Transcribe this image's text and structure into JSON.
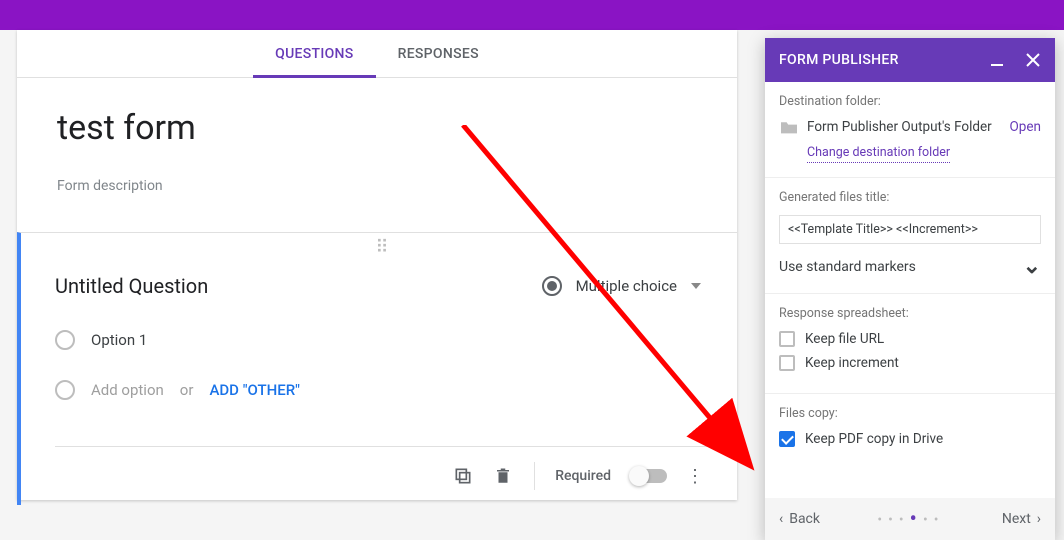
{
  "tabs": {
    "questions": "QUESTIONS",
    "responses": "RESPONSES"
  },
  "form": {
    "title": "test form",
    "description": "Form description"
  },
  "question": {
    "title": "Untitled Question",
    "type_label": "Multiple choice",
    "option1": "Option 1",
    "add_option": "Add option",
    "or": "or",
    "add_other": "ADD \"OTHER\"",
    "required": "Required"
  },
  "panel": {
    "title": "FORM PUBLISHER",
    "destination": {
      "label": "Destination folder:",
      "name": "Form Publisher Output's Folder",
      "open": "Open",
      "change": "Change destination folder"
    },
    "generated": {
      "label": "Generated files title:",
      "value": "<<Template Title>> <<Increment>>",
      "markers": "Use standard markers"
    },
    "spreadsheet": {
      "label": "Response spreadsheet:",
      "keep_url": "Keep file URL",
      "keep_increment": "Keep increment"
    },
    "copy": {
      "label": "Files copy:",
      "keep_pdf": "Keep PDF copy in Drive"
    },
    "footer": {
      "back": "Back",
      "next": "Next"
    }
  }
}
